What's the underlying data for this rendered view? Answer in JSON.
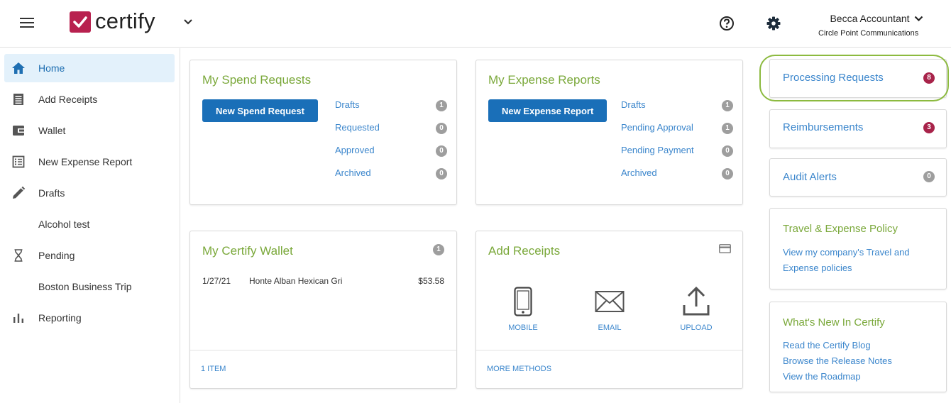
{
  "header": {
    "logo_text": "certify",
    "user_name": "Becca Accountant",
    "company": "Circle Point Communications",
    "icons": [
      "hamburger-icon",
      "checkmark-logo",
      "chevron-down-icon",
      "help-icon",
      "gear-icon"
    ]
  },
  "sidebar": {
    "items": [
      {
        "label": "Home",
        "icon": "home-icon",
        "active": true
      },
      {
        "label": "Add Receipts",
        "icon": "receipt-icon"
      },
      {
        "label": "Wallet",
        "icon": "wallet-icon"
      },
      {
        "label": "New Expense Report",
        "icon": "list-icon"
      },
      {
        "label": "Drafts",
        "icon": "pencil-icon"
      },
      {
        "label": "Alcohol test",
        "icon": ""
      },
      {
        "label": "Pending",
        "icon": "hourglass-icon"
      },
      {
        "label": "Boston Business Trip",
        "icon": ""
      },
      {
        "label": "Reporting",
        "icon": "bar-chart-icon"
      }
    ]
  },
  "spend": {
    "title": "My Spend Requests",
    "button": "New Spend Request",
    "statuses": [
      {
        "label": "Drafts",
        "count": "1"
      },
      {
        "label": "Requested",
        "count": "0"
      },
      {
        "label": "Approved",
        "count": "0"
      },
      {
        "label": "Archived",
        "count": "0"
      }
    ]
  },
  "expense": {
    "title": "My Expense Reports",
    "button": "New Expense Report",
    "statuses": [
      {
        "label": "Drafts",
        "count": "1"
      },
      {
        "label": "Pending Approval",
        "count": "1"
      },
      {
        "label": "Pending Payment",
        "count": "0"
      },
      {
        "label": "Archived",
        "count": "0"
      }
    ]
  },
  "wallet": {
    "title": "My Certify Wallet",
    "count": "1",
    "items": [
      {
        "date": "1/27/21",
        "merchant": "Honte Alban Hexican Gri",
        "amount": "$53.58"
      }
    ],
    "footer": "1 ITEM"
  },
  "receipts": {
    "title": "Add Receipts",
    "methods": [
      {
        "label": "MOBILE",
        "icon": "mobile-phone-icon"
      },
      {
        "label": "EMAIL",
        "icon": "envelope-icon"
      },
      {
        "label": "UPLOAD",
        "icon": "upload-icon"
      }
    ],
    "footer": "MORE METHODS",
    "icon": "credit-card-icon"
  },
  "right": {
    "processing": {
      "label": "Processing Requests",
      "count": "8"
    },
    "reimbursements": {
      "label": "Reimbursements",
      "count": "3"
    },
    "audit": {
      "label": "Audit Alerts",
      "count": "0"
    },
    "policy": {
      "title": "Travel & Expense Policy",
      "link": "View my company's Travel and Expense policies"
    },
    "whats_new": {
      "title": "What's New In Certify",
      "links": [
        "Read the Certify Blog",
        "Browse the Release Notes",
        "View the Roadmap"
      ]
    }
  },
  "colors": {
    "brand": "#b8214f",
    "accent_green": "#7aa83a",
    "link_blue": "#3b86cc",
    "button_blue": "#1a6fb8",
    "highlight_ring": "#8cba3f"
  }
}
